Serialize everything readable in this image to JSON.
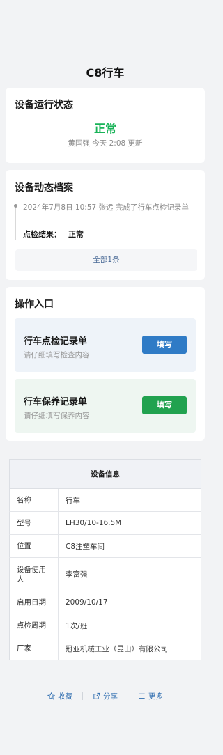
{
  "page": {
    "title": "C8行车"
  },
  "status_card": {
    "title": "设备运行状态",
    "status": "正常",
    "meta": "黄国强 今天 2:08 更新"
  },
  "archive_card": {
    "title": "设备动态档案",
    "record_text": "2024年7月8日 10:57  张远  完成了行车点检记录单",
    "result_label": "点检结果：",
    "result_value": "正常",
    "all_link": "全部1条"
  },
  "ops_card": {
    "title": "操作入口",
    "entries": [
      {
        "title": "行车点检记录单",
        "subtitle": "请仔细填写检查内容",
        "button": "填写"
      },
      {
        "title": "行车保养记录单",
        "subtitle": "请仔细填写保养内容",
        "button": "填写"
      }
    ]
  },
  "info": {
    "header": "设备信息",
    "rows": [
      {
        "key": "名称",
        "value": "行车"
      },
      {
        "key": "型号",
        "value": "LH30/10-16.5M"
      },
      {
        "key": "位置",
        "value": "C8注塑车间"
      },
      {
        "key": "设备使用人",
        "value": "李富强"
      },
      {
        "key": "启用日期",
        "value": "2009/10/17"
      },
      {
        "key": "点检周期",
        "value": "1次/班"
      },
      {
        "key": "厂家",
        "value": "冠亚机械工业（昆山）有限公司"
      }
    ]
  },
  "footer": {
    "favorite": "收藏",
    "share": "分享",
    "more": "更多"
  },
  "colors": {
    "status_green": "#19b358",
    "inspect_button": "#2f7bc6",
    "maint_button": "#21a24f",
    "link_blue": "#2f6db0"
  }
}
